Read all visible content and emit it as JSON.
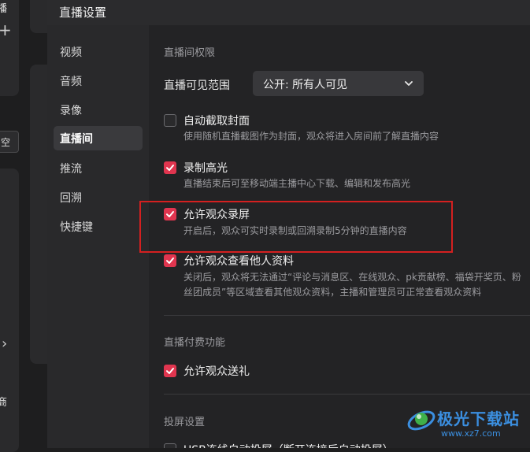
{
  "background_app": {
    "edge_text_top": "播",
    "edge_plus": "+",
    "edge_chip": "空",
    "edge_chevron": "›",
    "edge_text_bottom": "商"
  },
  "dialog": {
    "title": "直播设置"
  },
  "sidebar": {
    "items": [
      {
        "label": "视频"
      },
      {
        "label": "音频"
      },
      {
        "label": "录像"
      },
      {
        "label": "直播间",
        "active": true
      },
      {
        "label": "推流"
      },
      {
        "label": "回溯"
      },
      {
        "label": "快捷键"
      }
    ]
  },
  "permissions": {
    "section_title": "直播间权限",
    "visibility_label": "直播可见范围",
    "visibility_value": "公开: 所有人可见",
    "options": [
      {
        "label": "自动截取封面",
        "checked": false,
        "desc": [
          "使用随机直播截图作为封面，观众将进入房间前了解直播内容"
        ]
      },
      {
        "label": "录制高光",
        "checked": true,
        "desc": [
          "直播结束后可至移动端主播中心下载、编辑和发布高光"
        ]
      },
      {
        "label": "允许观众录屏",
        "checked": true,
        "desc": [
          "开启后，观众可实时录制或回溯录制5分钟的直播内容"
        ]
      },
      {
        "label": "允许观众查看他人资料",
        "checked": true,
        "desc": [
          "关闭后，观众将无法通过“评论与消息区、在线观众、pk贡献榜、福袋开奖页、粉",
          "丝团成员”等区域查看其他观众资料，主播和管理员可正常查看观众资料"
        ]
      }
    ]
  },
  "paid": {
    "section_title": "直播付费功能",
    "options": [
      {
        "label": "允许观众送礼",
        "checked": true
      }
    ]
  },
  "cast": {
    "section_title": "投屏设置",
    "partial_label": "USB连线自动投屏（断开连接后自动投屏）"
  },
  "watermark": {
    "brand": "极光下载站",
    "url": "www.xz7.com"
  },
  "colors": {
    "accent": "#e0354f",
    "highlight_box": "#d42020",
    "watermark": "#3b8fe0"
  }
}
